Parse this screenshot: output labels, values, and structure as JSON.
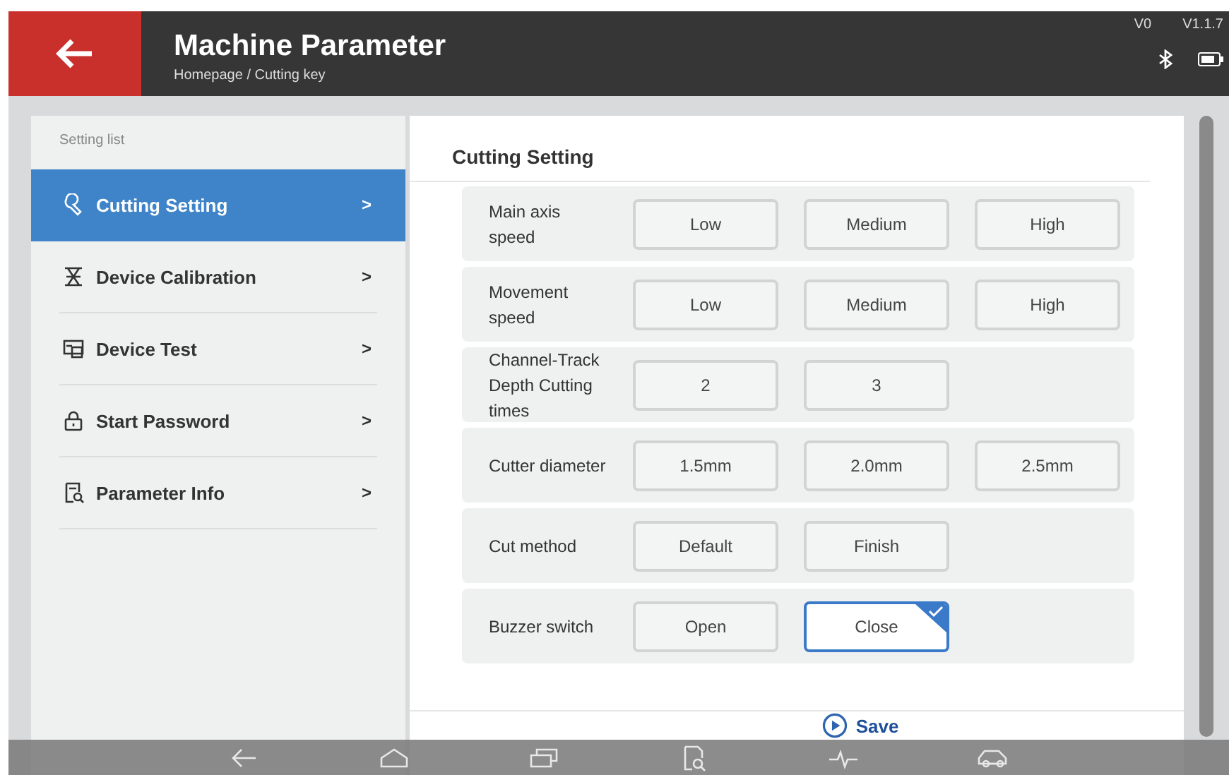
{
  "header": {
    "title": "Machine Parameter",
    "breadcrumb": "Homepage / Cutting key",
    "version_left": "V0",
    "version_right": "V1.1.7"
  },
  "sidebar": {
    "heading": "Setting list",
    "items": [
      {
        "label": "Cutting Setting",
        "chevron": ">",
        "selected": true
      },
      {
        "label": "Device Calibration",
        "chevron": ">",
        "selected": false
      },
      {
        "label": "Device Test",
        "chevron": ">",
        "selected": false
      },
      {
        "label": "Start Password",
        "chevron": ">",
        "selected": false
      },
      {
        "label": "Parameter Info",
        "chevron": ">",
        "selected": false
      }
    ]
  },
  "panel": {
    "title": "Cutting Setting",
    "rows": [
      {
        "label": "Main axis speed",
        "options": [
          {
            "label": "Low",
            "selected": false
          },
          {
            "label": "Medium",
            "selected": false
          },
          {
            "label": "High",
            "selected": false
          }
        ]
      },
      {
        "label": "Movement speed",
        "options": [
          {
            "label": "Low",
            "selected": false
          },
          {
            "label": "Medium",
            "selected": false
          },
          {
            "label": "High",
            "selected": false
          }
        ]
      },
      {
        "label": "Channel-Track Depth Cutting times",
        "options": [
          {
            "label": "2",
            "selected": false
          },
          {
            "label": "3",
            "selected": false
          }
        ]
      },
      {
        "label": "Cutter diameter",
        "options": [
          {
            "label": "1.5mm",
            "selected": false
          },
          {
            "label": "2.0mm",
            "selected": false
          },
          {
            "label": "2.5mm",
            "selected": false
          }
        ]
      },
      {
        "label": "Cut method",
        "options": [
          {
            "label": "Default",
            "selected": false
          },
          {
            "label": "Finish",
            "selected": false
          }
        ]
      },
      {
        "label": "Buzzer switch",
        "options": [
          {
            "label": "Open",
            "selected": false
          },
          {
            "label": "Close",
            "selected": true
          }
        ]
      }
    ],
    "save": "Save"
  }
}
